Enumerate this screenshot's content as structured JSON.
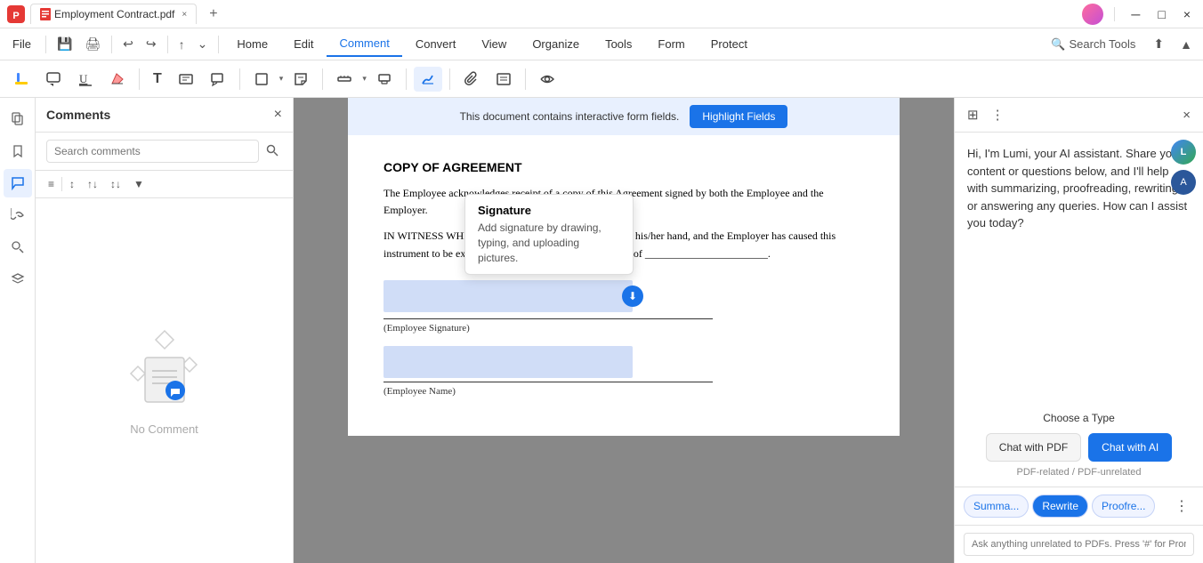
{
  "titlebar": {
    "tab_title": "Employment Contract.pdf",
    "close_icon": "×",
    "new_tab_icon": "+",
    "minimize_icon": "─",
    "maximize_icon": "□",
    "close_win_icon": "×"
  },
  "menubar": {
    "file_label": "File",
    "nav_items": [
      "Home",
      "Edit",
      "Comment",
      "Convert",
      "View",
      "Organize",
      "Tools",
      "Form",
      "Protect"
    ],
    "active_nav": "Comment",
    "search_tools_label": "Search Tools"
  },
  "toolbar": {
    "tools": [
      {
        "name": "highlight-tool",
        "icon": "✏",
        "label": "Highlight"
      },
      {
        "name": "comment-tool",
        "icon": "💬",
        "label": "Comment"
      },
      {
        "name": "underline-tool",
        "icon": "U̲",
        "label": "Underline"
      },
      {
        "name": "eraser-tool",
        "icon": "⌫",
        "label": "Eraser"
      },
      {
        "name": "text-tool",
        "icon": "T",
        "label": "Text"
      },
      {
        "name": "textbox-tool",
        "icon": "⊡",
        "label": "Textbox"
      },
      {
        "name": "callout-tool",
        "icon": "⬚",
        "label": "Callout"
      },
      {
        "name": "shape-tool",
        "icon": "□",
        "label": "Shape"
      },
      {
        "name": "note-tool",
        "icon": "💬",
        "label": "Note"
      },
      {
        "name": "measure-tool",
        "icon": "📐",
        "label": "Measure"
      },
      {
        "name": "stamp-tool",
        "icon": "🖃",
        "label": "Stamp"
      },
      {
        "name": "sign-tool",
        "icon": "✒",
        "label": "Sign"
      },
      {
        "name": "attach-tool",
        "icon": "📎",
        "label": "Attach"
      },
      {
        "name": "text-edit-tool",
        "icon": "📝",
        "label": "Text Edit"
      },
      {
        "name": "show-tool",
        "icon": "👁",
        "label": "Show"
      }
    ]
  },
  "left_sidebar": {
    "icons": [
      {
        "name": "pages-icon",
        "icon": "⊞",
        "label": "Pages"
      },
      {
        "name": "bookmark-icon",
        "icon": "🔖",
        "label": "Bookmark"
      },
      {
        "name": "comments-icon",
        "icon": "💬",
        "label": "Comments",
        "active": true
      },
      {
        "name": "links-icon",
        "icon": "🔗",
        "label": "Links"
      },
      {
        "name": "search-icon",
        "icon": "🔍",
        "label": "Search"
      },
      {
        "name": "layers-icon",
        "icon": "⊕",
        "label": "Layers"
      }
    ]
  },
  "comments_panel": {
    "title": "Comments",
    "close_icon": "×",
    "search_placeholder": "Search comments",
    "no_comment_label": "No Comment",
    "toolbar_icons": [
      "≡",
      "↕",
      "↑↓",
      "↕↓",
      "▼"
    ]
  },
  "pdf": {
    "notify_text": "This document contains interactive form fields.",
    "highlight_fields_btn": "Highlight Fields",
    "copy_title": "COPY OF AGREEMENT",
    "para1": "The Employee acknowledges receipt of a copy of this Agreement signed by both the Employee and the Employer.",
    "para2": "IN WITNESS WHEREOF, the Employee has hereunto set his/her hand, and the Employer has caused this instrument to be executed in its name and on its behalf, as of",
    "sig1_label": "(Employee Signature)",
    "sig2_label": "(Employee Name)"
  },
  "sig_tooltip": {
    "title": "Signature",
    "text": "Add signature by drawing, typing, and uploading pictures."
  },
  "ai_panel": {
    "greeting": "Hi, I'm Lumi, your AI assistant. Share your content or questions below, and I'll help with summarizing, proofreading, rewriting, or answering any queries. How can I assist you today?",
    "choose_type_label": "Choose a Type",
    "btn_chat_pdf": "Chat with PDF",
    "btn_chat_ai": "Chat with AI",
    "subtitle": "PDF-related / PDF-unrelated",
    "action_btns": [
      "Summa...",
      "Rewrite",
      "Proofre..."
    ],
    "input_placeholder": "Ask anything unrelated to PDFs. Press '#' for Prompts...",
    "more_icon": "⋮",
    "avatars": [
      {
        "name": "lumi-avatar",
        "label": "L"
      },
      {
        "name": "ms-avatar",
        "label": "A"
      }
    ],
    "close_icon": "×",
    "filter_icon": "⊞",
    "more_header_icon": "⋮"
  }
}
